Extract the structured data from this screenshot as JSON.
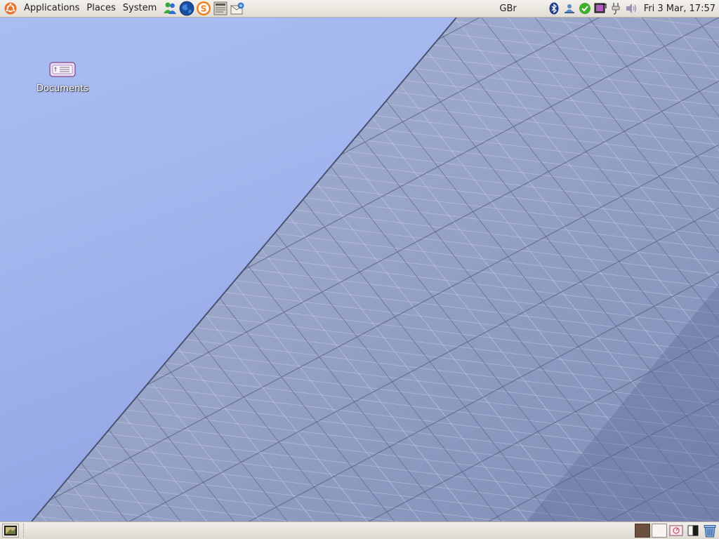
{
  "top_panel": {
    "menus": {
      "applications": "Applications",
      "places": "Places",
      "system": "System"
    },
    "launchers": [
      {
        "icon": "messenger-icon"
      },
      {
        "icon": "web-browser-icon"
      },
      {
        "icon": "skype-icon"
      },
      {
        "icon": "text-editor-icon"
      },
      {
        "icon": "mail-client-icon"
      }
    ],
    "keyboard_layout": "GBr",
    "tray": [
      {
        "icon": "bluetooth-icon"
      },
      {
        "icon": "network-icon"
      },
      {
        "icon": "update-notifier-icon"
      },
      {
        "icon": "display-icon"
      },
      {
        "icon": "power-icon"
      },
      {
        "icon": "volume-icon"
      }
    ],
    "clock": "Fri  3 Mar, 17:57"
  },
  "desktop": {
    "icons": [
      {
        "label": "Documents",
        "icon": "usb-drive-icon"
      }
    ]
  },
  "bottom_panel": {
    "show_desktop_icon": "show-desktop-icon",
    "workspaces": 2,
    "right_icons": [
      "workspace-switcher",
      "window-list-icon",
      "trash-icon"
    ]
  },
  "colors": {
    "panel_bg": "#e8e5de",
    "sky": "#a4b6ee",
    "active_workspace": "#6b5040"
  }
}
